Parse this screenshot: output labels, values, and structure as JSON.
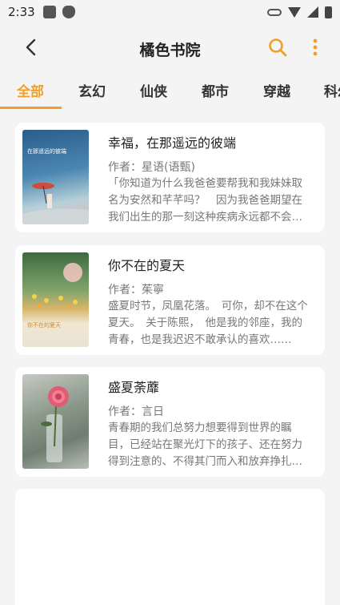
{
  "status": {
    "time": "2:33"
  },
  "appbar": {
    "title": "橘色书院"
  },
  "tabs": [
    {
      "label": "全部",
      "active": true
    },
    {
      "label": "玄幻",
      "active": false
    },
    {
      "label": "仙侠",
      "active": false
    },
    {
      "label": "都市",
      "active": false
    },
    {
      "label": "穿越",
      "active": false
    },
    {
      "label": "科幻",
      "active": false
    }
  ],
  "books": [
    {
      "title": "幸福，在那遥远的彼端",
      "author": "作者：星语(语甄)",
      "desc": "「你知道为什么我爸爸要帮我和我妹妹取名为安然和芊芊吗？　因为我爸爸期望在我们出生的那一刻这种疾病永远都不会出现在我们身上……",
      "cover_text": "在那遥远的彼端"
    },
    {
      "title": "你不在的夏天",
      "author": "作者：茱寧",
      "desc": "盛夏时节，凤凰花落。　可你，却不在这个夏天。　关于陈熙，　他是我的邻座，我的青春，也是我迟迟不敢承认的喜欢……",
      "cover_text": "你不在的夏天"
    },
    {
      "title": "盛夏荼蘼",
      "author": "作者：言日",
      "desc": "青春期的我们总努力想要得到世界的瞩目，已经站在聚光灯下的孩子、还在努力得到注意的、不得其门而入和放弃挣扎的……",
      "cover_text": ""
    }
  ],
  "colors": {
    "accent": "#f0a028",
    "background": "#f4f4f4"
  },
  "icons": {
    "back": "back-arrow-icon",
    "search": "search-icon",
    "more": "more-vertical-icon"
  }
}
